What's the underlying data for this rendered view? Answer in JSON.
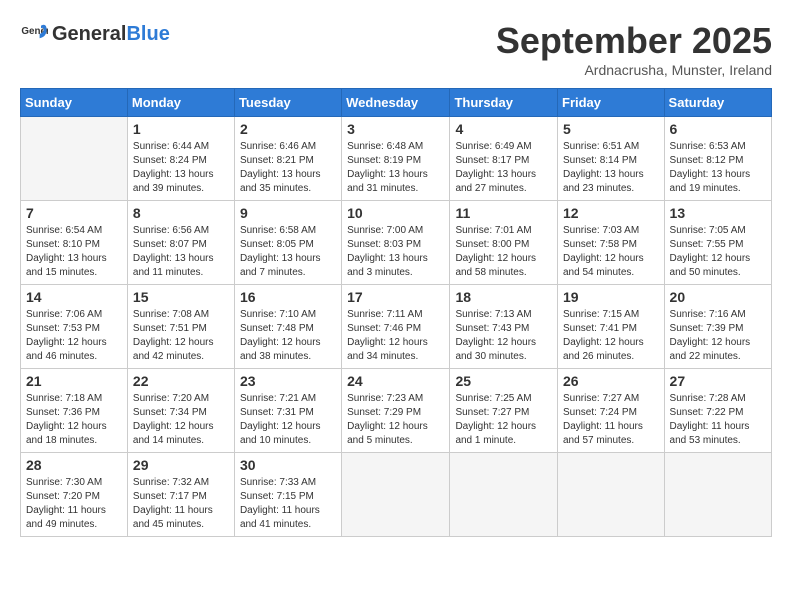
{
  "header": {
    "logo_general": "General",
    "logo_blue": "Blue",
    "month_title": "September 2025",
    "subtitle": "Ardnacrusha, Munster, Ireland"
  },
  "weekdays": [
    "Sunday",
    "Monday",
    "Tuesday",
    "Wednesday",
    "Thursday",
    "Friday",
    "Saturday"
  ],
  "weeks": [
    [
      {
        "day": "",
        "sunrise": "",
        "sunset": "",
        "daylight": ""
      },
      {
        "day": "1",
        "sunrise": "Sunrise: 6:44 AM",
        "sunset": "Sunset: 8:24 PM",
        "daylight": "Daylight: 13 hours and 39 minutes."
      },
      {
        "day": "2",
        "sunrise": "Sunrise: 6:46 AM",
        "sunset": "Sunset: 8:21 PM",
        "daylight": "Daylight: 13 hours and 35 minutes."
      },
      {
        "day": "3",
        "sunrise": "Sunrise: 6:48 AM",
        "sunset": "Sunset: 8:19 PM",
        "daylight": "Daylight: 13 hours and 31 minutes."
      },
      {
        "day": "4",
        "sunrise": "Sunrise: 6:49 AM",
        "sunset": "Sunset: 8:17 PM",
        "daylight": "Daylight: 13 hours and 27 minutes."
      },
      {
        "day": "5",
        "sunrise": "Sunrise: 6:51 AM",
        "sunset": "Sunset: 8:14 PM",
        "daylight": "Daylight: 13 hours and 23 minutes."
      },
      {
        "day": "6",
        "sunrise": "Sunrise: 6:53 AM",
        "sunset": "Sunset: 8:12 PM",
        "daylight": "Daylight: 13 hours and 19 minutes."
      }
    ],
    [
      {
        "day": "7",
        "sunrise": "Sunrise: 6:54 AM",
        "sunset": "Sunset: 8:10 PM",
        "daylight": "Daylight: 13 hours and 15 minutes."
      },
      {
        "day": "8",
        "sunrise": "Sunrise: 6:56 AM",
        "sunset": "Sunset: 8:07 PM",
        "daylight": "Daylight: 13 hours and 11 minutes."
      },
      {
        "day": "9",
        "sunrise": "Sunrise: 6:58 AM",
        "sunset": "Sunset: 8:05 PM",
        "daylight": "Daylight: 13 hours and 7 minutes."
      },
      {
        "day": "10",
        "sunrise": "Sunrise: 7:00 AM",
        "sunset": "Sunset: 8:03 PM",
        "daylight": "Daylight: 13 hours and 3 minutes."
      },
      {
        "day": "11",
        "sunrise": "Sunrise: 7:01 AM",
        "sunset": "Sunset: 8:00 PM",
        "daylight": "Daylight: 12 hours and 58 minutes."
      },
      {
        "day": "12",
        "sunrise": "Sunrise: 7:03 AM",
        "sunset": "Sunset: 7:58 PM",
        "daylight": "Daylight: 12 hours and 54 minutes."
      },
      {
        "day": "13",
        "sunrise": "Sunrise: 7:05 AM",
        "sunset": "Sunset: 7:55 PM",
        "daylight": "Daylight: 12 hours and 50 minutes."
      }
    ],
    [
      {
        "day": "14",
        "sunrise": "Sunrise: 7:06 AM",
        "sunset": "Sunset: 7:53 PM",
        "daylight": "Daylight: 12 hours and 46 minutes."
      },
      {
        "day": "15",
        "sunrise": "Sunrise: 7:08 AM",
        "sunset": "Sunset: 7:51 PM",
        "daylight": "Daylight: 12 hours and 42 minutes."
      },
      {
        "day": "16",
        "sunrise": "Sunrise: 7:10 AM",
        "sunset": "Sunset: 7:48 PM",
        "daylight": "Daylight: 12 hours and 38 minutes."
      },
      {
        "day": "17",
        "sunrise": "Sunrise: 7:11 AM",
        "sunset": "Sunset: 7:46 PM",
        "daylight": "Daylight: 12 hours and 34 minutes."
      },
      {
        "day": "18",
        "sunrise": "Sunrise: 7:13 AM",
        "sunset": "Sunset: 7:43 PM",
        "daylight": "Daylight: 12 hours and 30 minutes."
      },
      {
        "day": "19",
        "sunrise": "Sunrise: 7:15 AM",
        "sunset": "Sunset: 7:41 PM",
        "daylight": "Daylight: 12 hours and 26 minutes."
      },
      {
        "day": "20",
        "sunrise": "Sunrise: 7:16 AM",
        "sunset": "Sunset: 7:39 PM",
        "daylight": "Daylight: 12 hours and 22 minutes."
      }
    ],
    [
      {
        "day": "21",
        "sunrise": "Sunrise: 7:18 AM",
        "sunset": "Sunset: 7:36 PM",
        "daylight": "Daylight: 12 hours and 18 minutes."
      },
      {
        "day": "22",
        "sunrise": "Sunrise: 7:20 AM",
        "sunset": "Sunset: 7:34 PM",
        "daylight": "Daylight: 12 hours and 14 minutes."
      },
      {
        "day": "23",
        "sunrise": "Sunrise: 7:21 AM",
        "sunset": "Sunset: 7:31 PM",
        "daylight": "Daylight: 12 hours and 10 minutes."
      },
      {
        "day": "24",
        "sunrise": "Sunrise: 7:23 AM",
        "sunset": "Sunset: 7:29 PM",
        "daylight": "Daylight: 12 hours and 5 minutes."
      },
      {
        "day": "25",
        "sunrise": "Sunrise: 7:25 AM",
        "sunset": "Sunset: 7:27 PM",
        "daylight": "Daylight: 12 hours and 1 minute."
      },
      {
        "day": "26",
        "sunrise": "Sunrise: 7:27 AM",
        "sunset": "Sunset: 7:24 PM",
        "daylight": "Daylight: 11 hours and 57 minutes."
      },
      {
        "day": "27",
        "sunrise": "Sunrise: 7:28 AM",
        "sunset": "Sunset: 7:22 PM",
        "daylight": "Daylight: 11 hours and 53 minutes."
      }
    ],
    [
      {
        "day": "28",
        "sunrise": "Sunrise: 7:30 AM",
        "sunset": "Sunset: 7:20 PM",
        "daylight": "Daylight: 11 hours and 49 minutes."
      },
      {
        "day": "29",
        "sunrise": "Sunrise: 7:32 AM",
        "sunset": "Sunset: 7:17 PM",
        "daylight": "Daylight: 11 hours and 45 minutes."
      },
      {
        "day": "30",
        "sunrise": "Sunrise: 7:33 AM",
        "sunset": "Sunset: 7:15 PM",
        "daylight": "Daylight: 11 hours and 41 minutes."
      },
      {
        "day": "",
        "sunrise": "",
        "sunset": "",
        "daylight": ""
      },
      {
        "day": "",
        "sunrise": "",
        "sunset": "",
        "daylight": ""
      },
      {
        "day": "",
        "sunrise": "",
        "sunset": "",
        "daylight": ""
      },
      {
        "day": "",
        "sunrise": "",
        "sunset": "",
        "daylight": ""
      }
    ]
  ]
}
